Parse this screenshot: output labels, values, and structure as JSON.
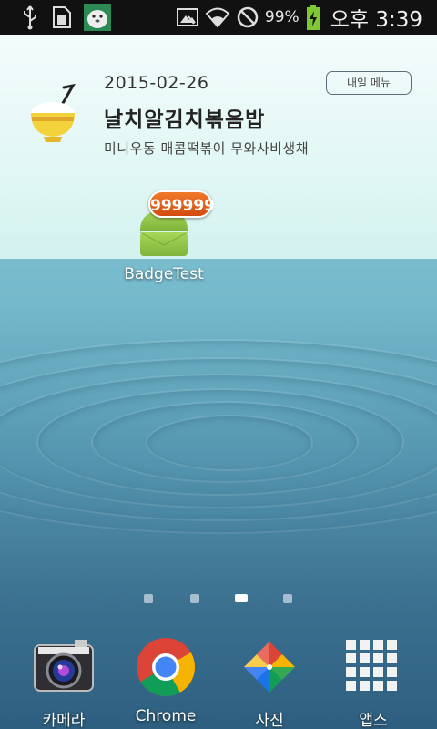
{
  "status_bar": {
    "battery_percent": "99%",
    "time": "오후 3:39",
    "icons": [
      "usb-icon",
      "sim-icon",
      "seal-app-icon",
      "screenshot-icon",
      "wifi-icon",
      "no-sign-icon",
      "battery-charging-icon"
    ]
  },
  "widget": {
    "date": "2015-02-26",
    "main_dish": "날치알김치볶음밥",
    "side_dishes": "미니우동 매콤떡볶이 무와사비생채",
    "tomorrow_button": "내일 메뉴",
    "icon": "rice-bowl-icon"
  },
  "home_app": {
    "label": "BadgeTest",
    "badge_count": "999999",
    "icon": "android-icon"
  },
  "page_indicator": {
    "total": 4,
    "active_index": 2
  },
  "dock": {
    "items": [
      {
        "label": "카메라",
        "icon": "camera-icon"
      },
      {
        "label": "Chrome",
        "icon": "chrome-icon"
      },
      {
        "label": "사진",
        "icon": "photos-icon"
      },
      {
        "label": "앱스",
        "icon": "apps-grid-icon"
      }
    ]
  },
  "colors": {
    "badge": "#e05a17",
    "status_bar": "#111111",
    "widget_bg": "#e1f7f5"
  }
}
